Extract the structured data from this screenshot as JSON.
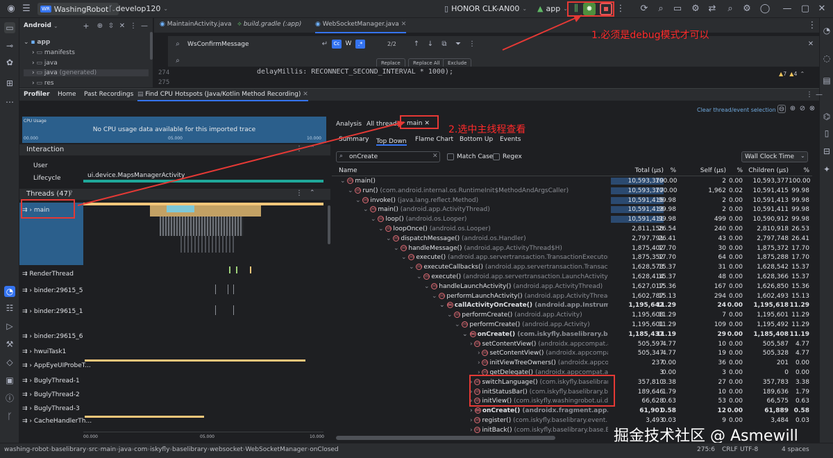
{
  "topbar": {
    "project": "WashingRobot",
    "project_badge": "WR",
    "branch": "develop120",
    "device": "HONOR CLK-AN00",
    "run_config": "app"
  },
  "project_tree": {
    "header": "Android",
    "items": [
      "app",
      "manifests",
      "java",
      "java",
      "(generated)",
      "res"
    ]
  },
  "editor": {
    "tabs": [
      "MaintainActivity.java",
      "build.gradle (:app)",
      "WebSocketManager.java"
    ],
    "find_query": "WsConfirmMessage",
    "match_count": "2/2",
    "replace_buttons": [
      "Replace",
      "Replace All",
      "Exclude"
    ],
    "line_numbers": [
      "274",
      "275"
    ],
    "code_line": "delayMillis: RECONNECT_SECOND_INTERVAL * 1000);",
    "inspection_counts": [
      "7",
      "4"
    ]
  },
  "profiler": {
    "tabs": [
      "Profiler",
      "Home",
      "Past Recordings",
      "Find CPU Hotspots (Java/Kotlin Method Recording)"
    ],
    "clear_selection": "Clear thread/event selection",
    "cpu_usage_label": "CPU Usage",
    "cpu_usage_msg": "No CPU usage data available for this imported trace",
    "time_ticks": [
      "00.000",
      "05.000",
      "10.000"
    ],
    "interaction_header": "Interaction",
    "interaction_rows": [
      "User",
      "Lifecycle"
    ],
    "lifecycle_activity": "ui.device.MapsManagerActivity",
    "threads_header": "Threads (47)",
    "threads": [
      "main",
      "RenderThread",
      "binder:29615_5",
      "binder:29615_1",
      "binder:29615_6",
      "hwuiTask1",
      "AppEyeUIProbeT...",
      "BuglyThread-1",
      "BuglyThread-2",
      "BuglyThread-3",
      "CacheHandlerTh..."
    ]
  },
  "analysis": {
    "tabs": [
      "Analysis",
      "All threads",
      "main"
    ],
    "subtabs": [
      "Summary",
      "Top Down",
      "Flame Chart",
      "Bottom Up",
      "Events"
    ],
    "filter_value": "onCreate",
    "match_case": "Match Case",
    "regex": "Regex",
    "clock": "Wall Clock Time",
    "columns": [
      "Name",
      "Total (μs)",
      "%",
      "Self (μs)",
      "%",
      "Children (μs)",
      "%"
    ],
    "rows": [
      {
        "name": "main()",
        "pkg": "",
        "total": "10,593,379",
        "tp": "100.00",
        "self": "2",
        "sp": "0.00",
        "children": "10,593,377",
        "cp": "100.00",
        "bold": false,
        "hi": true,
        "depth": 0
      },
      {
        "name": "run()",
        "pkg": "(com.android.internal.os.RuntimeInit$MethodAndArgsCaller)",
        "total": "10,593,377",
        "tp": "100.00",
        "self": "1,962",
        "sp": "0.02",
        "children": "10,591,415",
        "cp": "99.98",
        "bold": false,
        "hi": true,
        "depth": 1
      },
      {
        "name": "invoke()",
        "pkg": "(java.lang.reflect.Method)",
        "total": "10,591,415",
        "tp": "99.98",
        "self": "2",
        "sp": "0.00",
        "children": "10,591,413",
        "cp": "99.98",
        "bold": false,
        "hi": true,
        "depth": 2
      },
      {
        "name": "main()",
        "pkg": "(android.app.ActivityThread)",
        "total": "10,591,413",
        "tp": "99.98",
        "self": "2",
        "sp": "0.00",
        "children": "10,591,411",
        "cp": "99.98",
        "bold": false,
        "hi": true,
        "depth": 3
      },
      {
        "name": "loop()",
        "pkg": "(android.os.Looper)",
        "total": "10,591,411",
        "tp": "99.98",
        "self": "499",
        "sp": "0.00",
        "children": "10,590,912",
        "cp": "99.98",
        "bold": false,
        "hi": true,
        "depth": 4
      },
      {
        "name": "loopOnce()",
        "pkg": "(android.os.Looper)",
        "total": "2,811,158",
        "tp": "26.54",
        "self": "240",
        "sp": "0.00",
        "children": "2,810,918",
        "cp": "26.53",
        "bold": false,
        "hi": false,
        "depth": 5
      },
      {
        "name": "dispatchMessage()",
        "pkg": "(android.os.Handler)",
        "total": "2,797,791",
        "tp": "26.41",
        "self": "43",
        "sp": "0.00",
        "children": "2,797,748",
        "cp": "26.41",
        "bold": false,
        "hi": false,
        "depth": 6
      },
      {
        "name": "handleMessage()",
        "pkg": "(android.app.ActivityThread$H)",
        "total": "1,875,402",
        "tp": "17.70",
        "self": "30",
        "sp": "0.00",
        "children": "1,875,372",
        "cp": "17.70",
        "bold": false,
        "hi": false,
        "depth": 7
      },
      {
        "name": "execute()",
        "pkg": "(android.app.servertransaction.TransactionExecutor)",
        "total": "1,875,352",
        "tp": "17.70",
        "self": "64",
        "sp": "0.00",
        "children": "1,875,288",
        "cp": "17.70",
        "bold": false,
        "hi": false,
        "depth": 8
      },
      {
        "name": "executeCallbacks()",
        "pkg": "(android.app.servertransaction.TransactionExecutor)",
        "total": "1,628,573",
        "tp": "15.37",
        "self": "31",
        "sp": "0.00",
        "children": "1,628,542",
        "cp": "15.37",
        "bold": false,
        "hi": false,
        "depth": 9
      },
      {
        "name": "execute()",
        "pkg": "(android.app.servertransaction.LaunchActivityItem)",
        "total": "1,628,414",
        "tp": "15.37",
        "self": "48",
        "sp": "0.00",
        "children": "1,628,366",
        "cp": "15.37",
        "bold": false,
        "hi": false,
        "depth": 10
      },
      {
        "name": "handleLaunchActivity()",
        "pkg": "(android.app.ActivityThread)",
        "total": "1,627,017",
        "tp": "15.36",
        "self": "167",
        "sp": "0.00",
        "children": "1,626,850",
        "cp": "15.36",
        "bold": false,
        "hi": false,
        "depth": 11
      },
      {
        "name": "performLaunchActivity()",
        "pkg": "(android.app.ActivityThread)",
        "total": "1,602,787",
        "tp": "15.13",
        "self": "294",
        "sp": "0.00",
        "children": "1,602,493",
        "cp": "15.13",
        "bold": false,
        "hi": false,
        "depth": 12
      },
      {
        "name": "callActivityOnCreate()",
        "pkg": "(android.app.Instrumentation)",
        "total": "1,195,642",
        "tp": "11.29",
        "self": "24",
        "sp": "0.00",
        "children": "1,195,618",
        "cp": "11.29",
        "bold": true,
        "hi": false,
        "depth": 13
      },
      {
        "name": "performCreate()",
        "pkg": "(android.app.Activity)",
        "total": "1,195,608",
        "tp": "11.29",
        "self": "7",
        "sp": "0.00",
        "children": "1,195,601",
        "cp": "11.29",
        "bold": false,
        "hi": false,
        "depth": 14
      },
      {
        "name": "performCreate()",
        "pkg": "(android.app.Activity)",
        "total": "1,195,601",
        "tp": "11.29",
        "self": "109",
        "sp": "0.00",
        "children": "1,195,492",
        "cp": "11.29",
        "bold": false,
        "hi": false,
        "depth": 15
      },
      {
        "name": "onCreate()",
        "pkg": "(com.iskyfly.baselibrary.base.BaseActi",
        "total": "1,185,437",
        "tp": "11.19",
        "self": "29",
        "sp": "0.00",
        "children": "1,185,408",
        "cp": "11.19",
        "bold": true,
        "hi": false,
        "depth": 16
      },
      {
        "name": "setContentView()",
        "pkg": "(androidx.appcompat.app.Ap",
        "total": "505,597",
        "tp": "4.77",
        "self": "10",
        "sp": "0.00",
        "children": "505,587",
        "cp": "4.77",
        "bold": false,
        "hi": false,
        "depth": 17
      },
      {
        "name": "setContentView()",
        "pkg": "(androidx.appcompat.app.Ap",
        "total": "505,347",
        "tp": "4.77",
        "self": "19",
        "sp": "0.00",
        "children": "505,328",
        "cp": "4.77",
        "bold": false,
        "hi": false,
        "depth": 18
      },
      {
        "name": "initViewTreeOwners()",
        "pkg": "(androidx.appcompat.",
        "total": "237",
        "tp": "0.00",
        "self": "36",
        "sp": "0.00",
        "children": "201",
        "cp": "0.00",
        "bold": false,
        "hi": false,
        "depth": 18
      },
      {
        "name": "getDelegate()",
        "pkg": "(androidx.appcompat.app.App",
        "total": "3",
        "tp": "0.00",
        "self": "3",
        "sp": "0.00",
        "children": "0",
        "cp": "0.00",
        "bold": false,
        "hi": false,
        "depth": 18
      },
      {
        "name": "switchLanguage()",
        "pkg": "(com.iskyfly.baselibrary.utils.",
        "total": "357,810",
        "tp": "3.38",
        "self": "27",
        "sp": "0.00",
        "children": "357,783",
        "cp": "3.38",
        "bold": false,
        "hi": false,
        "depth": 17
      },
      {
        "name": "initStatusBar()",
        "pkg": "(com.iskyfly.baselibrary.base.Bas",
        "total": "189,646",
        "tp": "1.79",
        "self": "10",
        "sp": "0.00",
        "children": "189,636",
        "cp": "1.79",
        "bold": false,
        "hi": false,
        "depth": 17
      },
      {
        "name": "initView()",
        "pkg": "(com.iskyfly.washingrobot.ui.device.M",
        "total": "66,628",
        "tp": "0.63",
        "self": "53",
        "sp": "0.00",
        "children": "66,575",
        "cp": "0.63",
        "bold": false,
        "hi": false,
        "depth": 17
      },
      {
        "name": "onCreate()",
        "pkg": "(androidx.fragment.app.FragmentA",
        "total": "61,901",
        "tp": "0.58",
        "self": "12",
        "sp": "0.00",
        "children": "61,889",
        "cp": "0.58",
        "bold": true,
        "hi": false,
        "depth": 17
      },
      {
        "name": "register()",
        "pkg": "(com.iskyfly.baselibrary.event.EventM",
        "total": "3,493",
        "tp": "0.03",
        "self": "9",
        "sp": "0.00",
        "children": "3,484",
        "cp": "0.03",
        "bold": false,
        "hi": false,
        "depth": 17
      },
      {
        "name": "initBack()",
        "pkg": "(com.iskyfly.baselibrary.base.BaseAct",
        "total": "",
        "tp": "",
        "self": "",
        "sp": "",
        "children": "",
        "cp": "",
        "bold": false,
        "hi": false,
        "depth": 17
      }
    ]
  },
  "annotations": {
    "a1": "1.必须是debug模式才可以",
    "a2": "2.选中主线程查看",
    "watermark": "掘金技术社区 @ Asmewill"
  },
  "statusbar": {
    "crumbs": [
      "washing-robot",
      "baselibrary",
      "src",
      "main",
      "java",
      "com",
      "iskyfly",
      "baselibrary",
      "websocket",
      "WebSocketManager",
      "onClosed"
    ],
    "right": [
      "275:6",
      "CRLF",
      "UTF-8",
      "4 spaces"
    ]
  }
}
